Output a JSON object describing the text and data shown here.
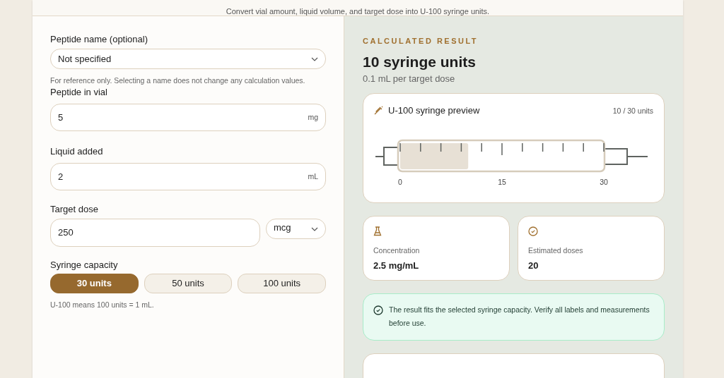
{
  "header": {
    "subtitle": "Convert vial amount, liquid volume, and target dose into U-100 syringe units."
  },
  "form": {
    "peptide_name": {
      "label": "Peptide name (optional)",
      "value": "Not specified",
      "hint": "For reference only. Selecting a name does not change any calculation values."
    },
    "peptide_in_vial": {
      "label": "Peptide in vial",
      "value": "5",
      "unit": "mg"
    },
    "liquid_added": {
      "label": "Liquid added",
      "value": "2",
      "unit": "mL"
    },
    "target_dose": {
      "label": "Target dose",
      "value": "250",
      "unit": "mcg"
    },
    "syringe_capacity": {
      "label": "Syringe capacity",
      "options": [
        {
          "label": "30 units",
          "selected": true
        },
        {
          "label": "50 units",
          "selected": false
        },
        {
          "label": "100 units",
          "selected": false
        }
      ],
      "note": "U-100 means 100 units = 1 mL."
    }
  },
  "result": {
    "eyebrow": "CALCULATED RESULT",
    "title": "10 syringe units",
    "subtitle": "0.1 mL per target dose",
    "syringe": {
      "title": "U-100 syringe preview",
      "reading": "10 / 30 units",
      "level": 0.333,
      "scale": [
        "0",
        "15",
        "30"
      ]
    },
    "stats": [
      {
        "kind": "flask",
        "label": "Concentration",
        "value": "2.5 mg/mL"
      },
      {
        "kind": "check",
        "label": "Estimated doses",
        "value": "20"
      }
    ],
    "alert": {
      "text": "The result fits the selected syringe capacity. Verify all labels and measurements before use."
    }
  }
}
